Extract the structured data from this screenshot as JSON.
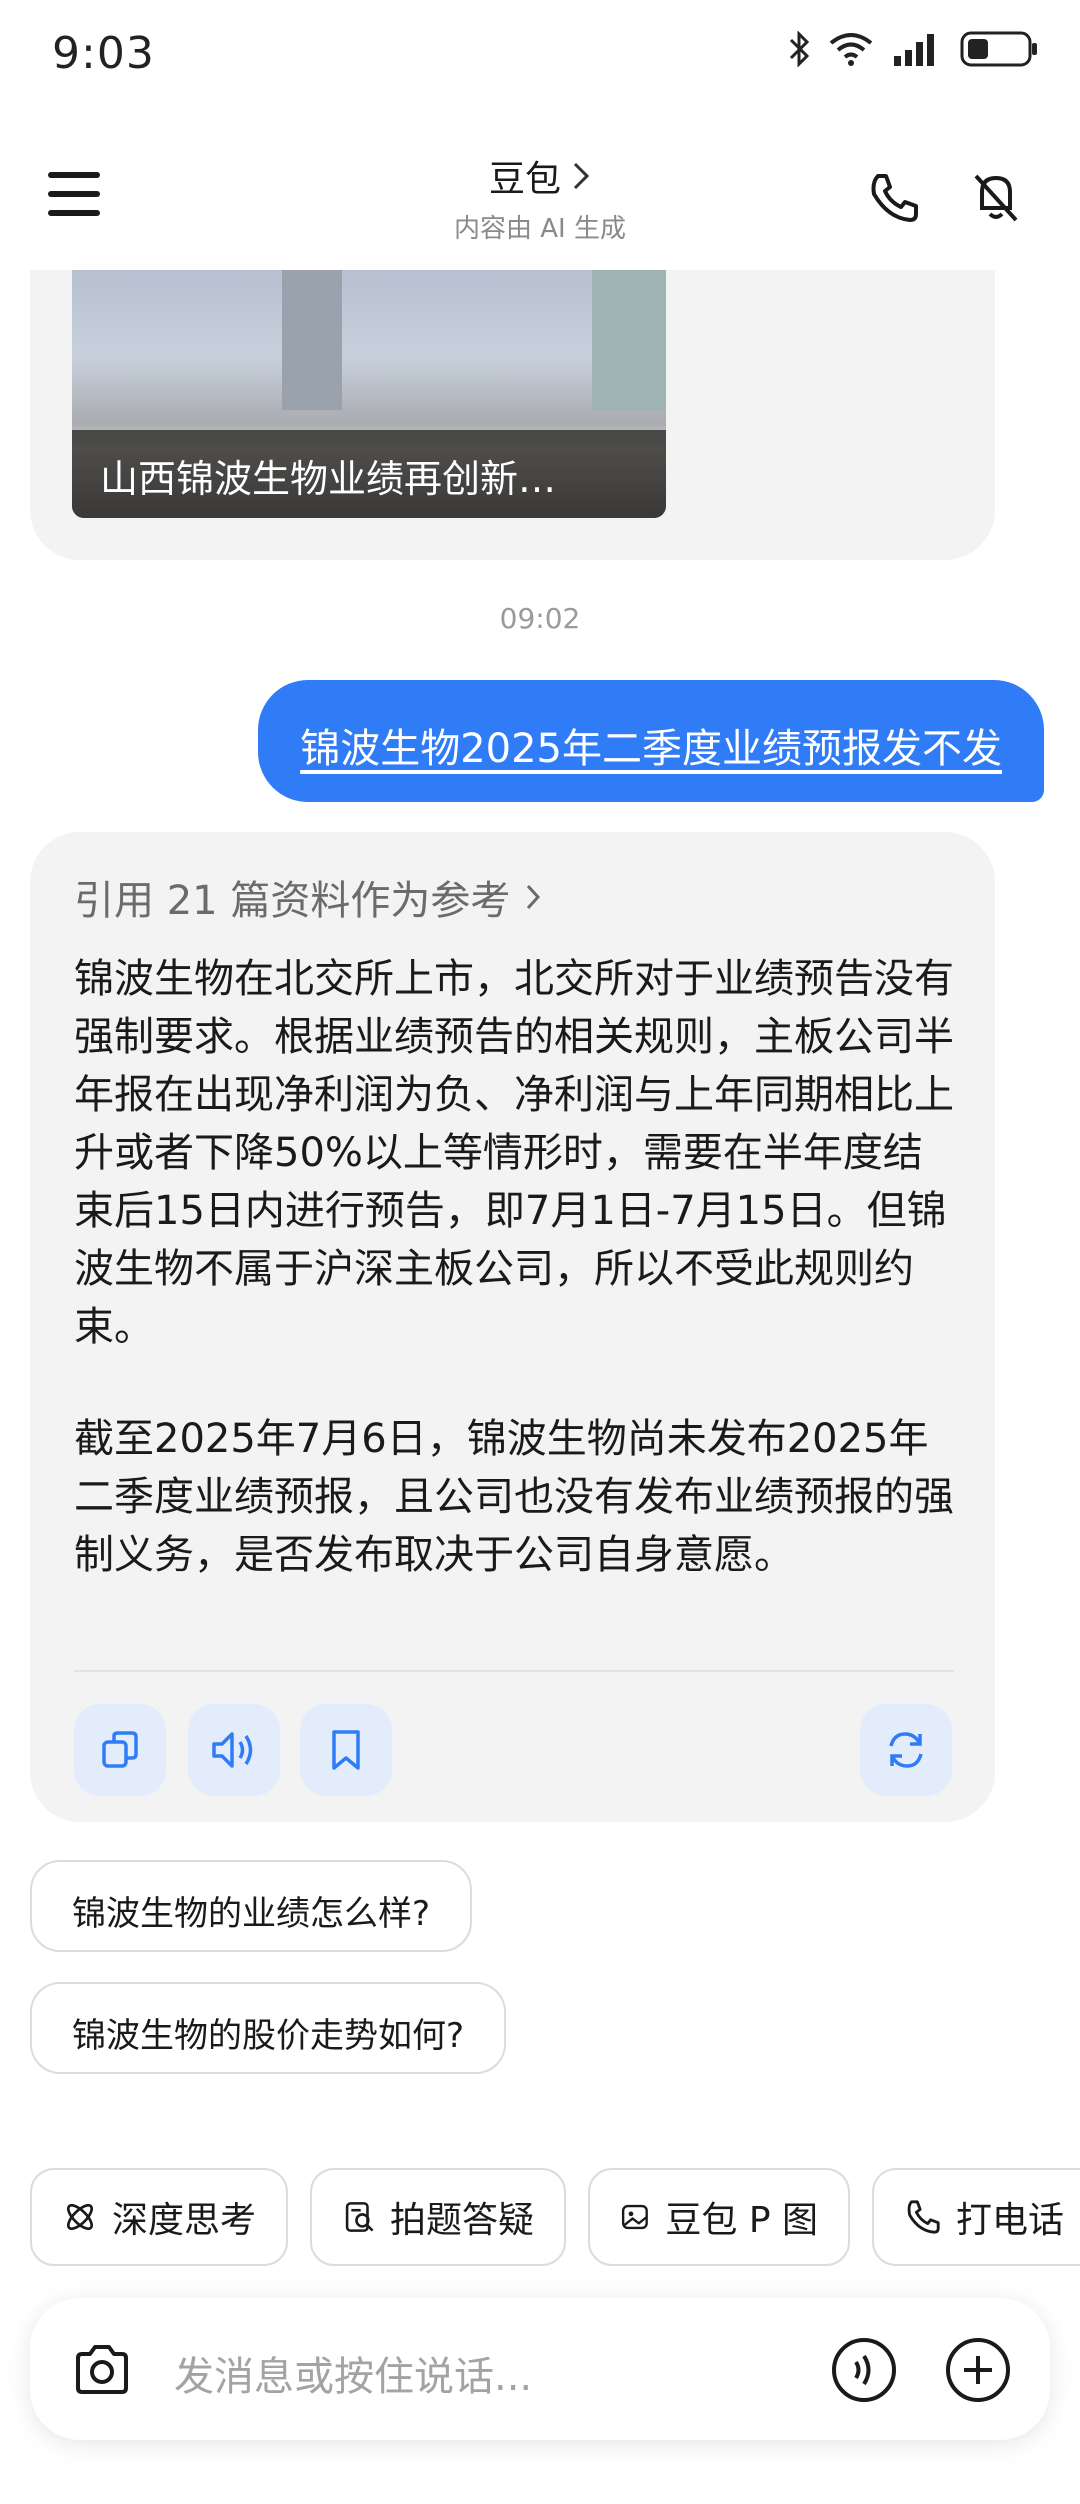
{
  "status": {
    "time": "9:03"
  },
  "header": {
    "title": "豆包",
    "subtitle": "内容由 AI 生成"
  },
  "news_card": {
    "caption": "山西锦波生物业绩再创新…"
  },
  "timestamp": "09:02",
  "user_message": "锦波生物2025年二季度业绩预报发不发",
  "ai_message": {
    "reference": "引用 21 篇资料作为参考",
    "paragraphs": [
      "锦波生物在北交所上市，北交所对于业绩预告没有强制要求。根据业绩预告的相关规则，主板公司半年报在出现净利润为负、净利润与上年同期相比上升或者下降50%以上等情形时，需要在半年度结束后15日内进行预告，即7月1日-7月15日。但锦波生物不属于沪深主板公司，所以不受此规则约束。",
      "截至2025年7月6日，锦波生物尚未发布2025年二季度业绩预报，且公司也没有发布业绩预报的强制义务，是否发布取决于公司自身意愿。"
    ]
  },
  "suggestions": [
    "锦波生物的业绩怎么样?",
    "锦波生物的股价走势如何?"
  ],
  "quick_actions": [
    {
      "label": "深度思考",
      "icon": "atom-icon"
    },
    {
      "label": "拍题答疑",
      "icon": "scan-question-icon"
    },
    {
      "label": "豆包 P 图",
      "icon": "image-edit-icon"
    },
    {
      "label": "打电话",
      "icon": "phone-icon"
    }
  ],
  "input": {
    "placeholder": "发消息或按住说话..."
  },
  "colors": {
    "accent": "#2f7cf6",
    "bubble": "#f3f3f4",
    "action_bg": "#e3ecfb"
  }
}
